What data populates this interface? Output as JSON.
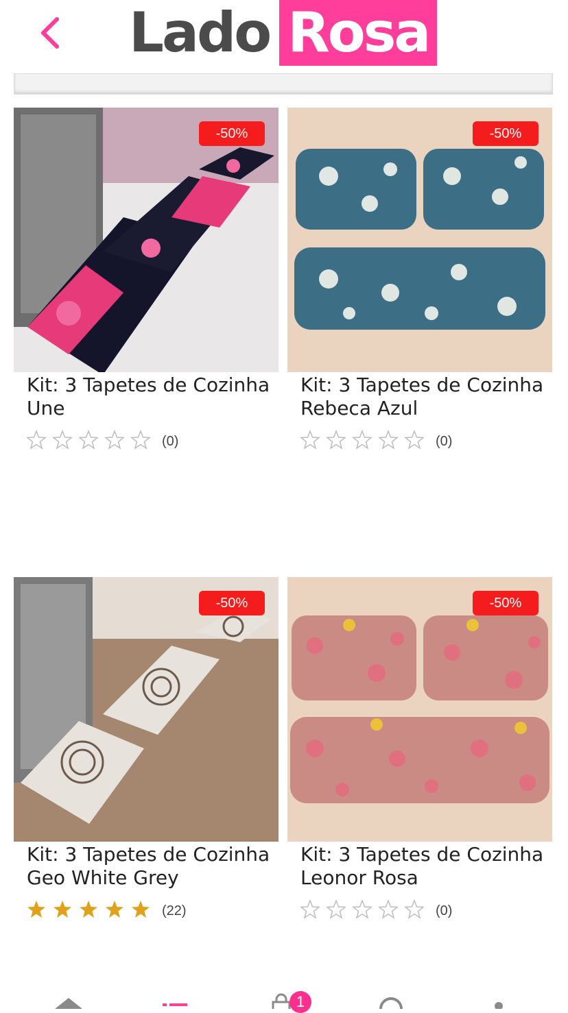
{
  "header": {
    "back_icon": "chevron-left-icon",
    "logo_part1": "Lado",
    "logo_part2": "Rosa",
    "brand_color": "#ff3d9a"
  },
  "products": [
    {
      "title": "Kit: 3 Tapetes de Cozinha Une",
      "discount": "-50%",
      "rating": 0,
      "rating_count": "(0)"
    },
    {
      "title": "Kit: 3 Tapetes de Cozinha Rebeca Azul",
      "discount": "-50%",
      "rating": 0,
      "rating_count": "(0)"
    },
    {
      "title": "Kit: 3 Tapetes de Cozinha Geo White Grey",
      "discount": "-50%",
      "rating": 5,
      "rating_count": "(22)"
    },
    {
      "title": "Kit: 3 Tapetes de Cozinha Leonor Rosa",
      "discount": "-50%",
      "rating": 0,
      "rating_count": "(0)"
    }
  ],
  "tabbar": {
    "items": [
      "home-icon",
      "categories-icon",
      "cart-icon",
      "search-icon",
      "account-icon"
    ],
    "cart_count": "1"
  },
  "colors": {
    "badge": "#f41c1c",
    "star_filled": "#e0a21a",
    "star_empty": "#bdbdbd"
  }
}
